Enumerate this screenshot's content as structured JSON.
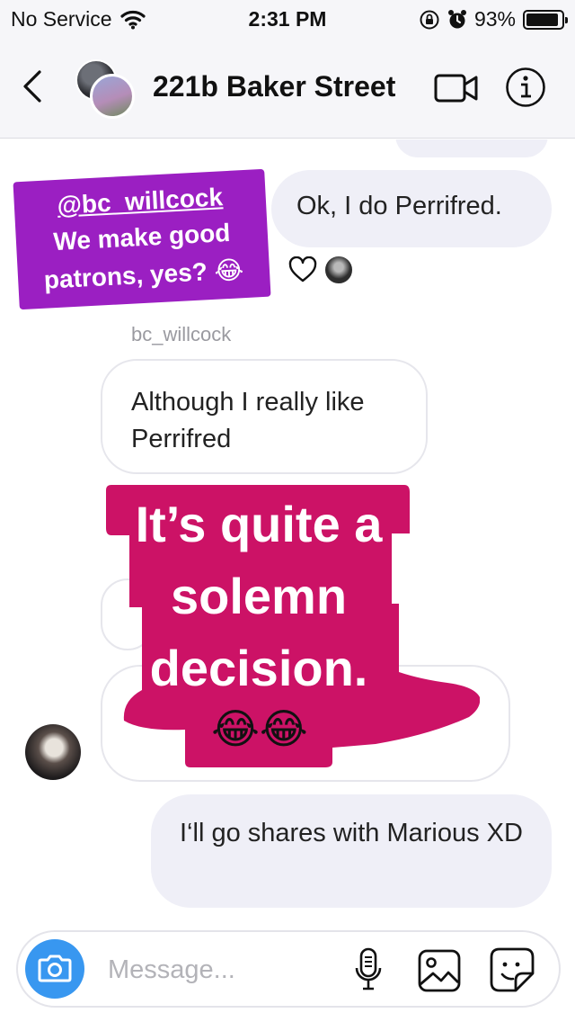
{
  "status_bar": {
    "carrier": "No Service",
    "time": "2:31 PM",
    "battery": "93%",
    "battery_level": 0.93
  },
  "header": {
    "title": "221b Baker Street",
    "icons": [
      "back-icon",
      "video-call-icon",
      "info-icon"
    ]
  },
  "messages": {
    "story_reply": {
      "mention": "@bc_willcock",
      "line1": "We make good",
      "line2": "patrons, yes? 😂"
    },
    "sent_1": "Ok, I do Perrifred.",
    "sender_name": "bc_willcock",
    "received_1": "Although I really like Perrifred",
    "sticker": {
      "text": "It’s quite a solemn decision.",
      "emoji": "😂😂",
      "color": "#cc1266"
    },
    "sent_2": "I‘ll go shares with Marious XD"
  },
  "composer": {
    "placeholder": "Message...",
    "camera_color": "#3897f0",
    "icons": [
      "camera-icon",
      "microphone-icon",
      "gallery-icon",
      "sticker-icon"
    ]
  },
  "colors": {
    "story_purple": "#9b1fc2",
    "sent_bubble": "#efeff7",
    "accent_blue": "#3897f0"
  }
}
